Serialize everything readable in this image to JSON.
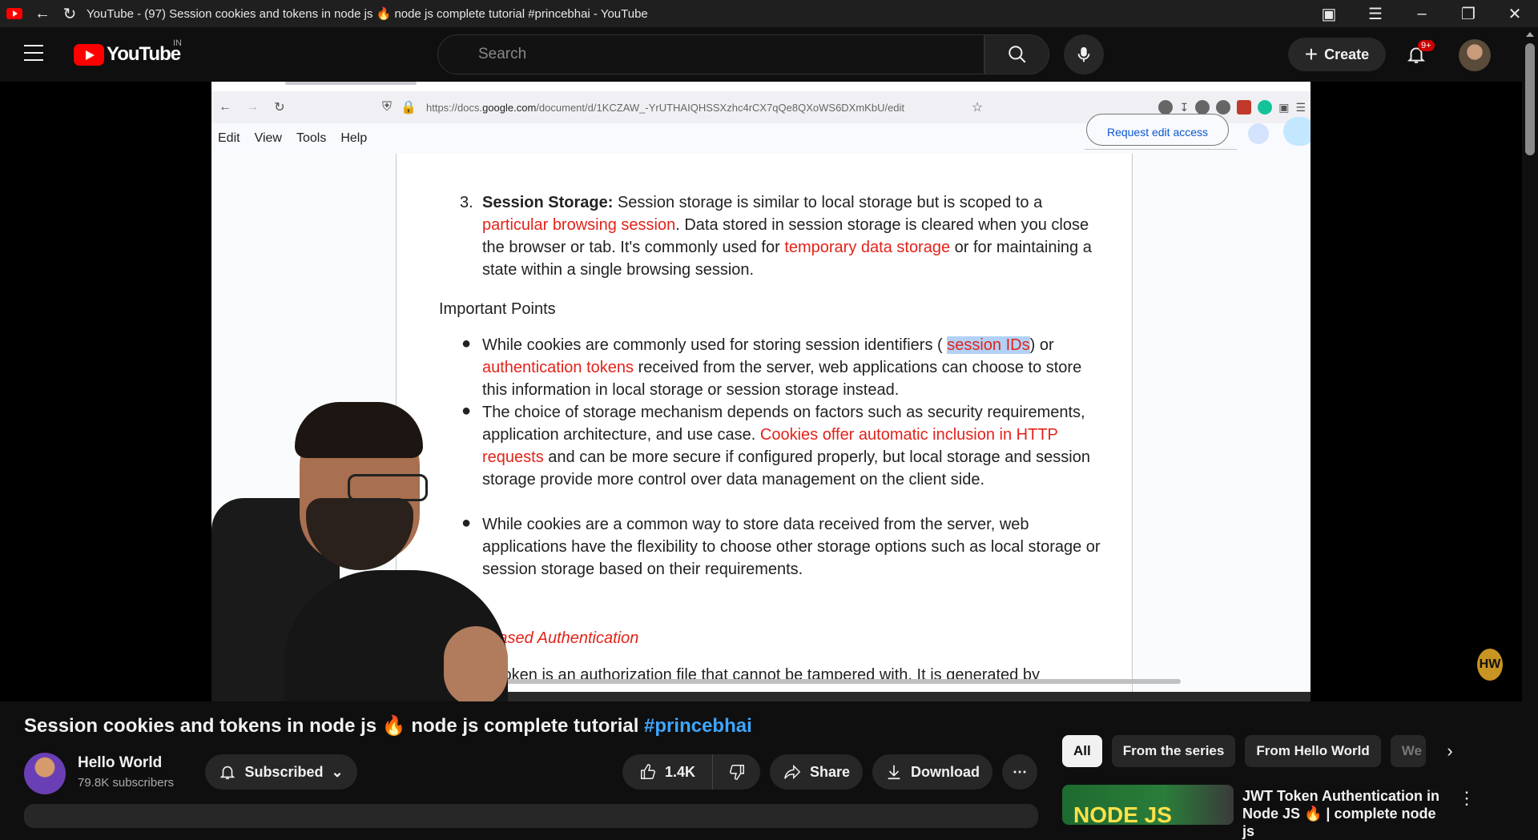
{
  "window": {
    "title": "YouTube - (97) Session cookies and tokens in node js 🔥 node js complete tutorial #princebhai - YouTube"
  },
  "masthead": {
    "logo_text": "YouTube",
    "country_code": "IN",
    "search_placeholder": "Search",
    "create_label": "Create",
    "notification_badge": "9+"
  },
  "inner_browser": {
    "url_prefix": "https://docs.",
    "url_domain": "google.com",
    "url_rest": "/document/d/1KCZAW_-YrUTHAIQHSSXzhc4rCX7qQe8QXoWS6DXmKbU/edit",
    "docs_menu": [
      "Edit",
      "View",
      "Tools",
      "Help"
    ],
    "request_edit": "Request edit access"
  },
  "document": {
    "item_number": "3.",
    "session_storage_label": "Session Storage:",
    "session_storage_text_1": " Session storage is similar to local storage but is scoped to a ",
    "session_storage_red_1": "particular browsing session",
    "session_storage_text_2": ". Data stored in session storage is cleared when you close the browser or tab. It's commonly used for ",
    "session_storage_red_2": "temporary data storage",
    "session_storage_text_3": " or for maintaining a state within a single browsing session.",
    "important_points": "Important Points",
    "bullet1_text_1": "While cookies are commonly used for storing session identifiers ( ",
    "bullet1_highlight": "session IDs",
    "bullet1_text_2": ") or ",
    "bullet1_red": "authentication tokens",
    "bullet1_text_3": " received from the server, web applications can choose to store this information in local storage or session storage instead.",
    "bullet2_text_1": "The choice of storage mechanism depends on factors such as security requirements, application architecture, and use case. ",
    "bullet2_red": "Cookies offer automatic inclusion in HTTP requests",
    "bullet2_text_2": " and can be more secure if configured properly, but local storage and session storage provide more control over data management on the client side.",
    "bullet3_text": "While cookies are a common way to store data received from the server, web applications have the flexibility to choose other storage options such as local storage or session storage based on their requirements.",
    "token_heading": "Token based Authentication",
    "token_line": "token is an authorization file that cannot be tampered with. It is generated by"
  },
  "video": {
    "title_main": "Session cookies and tokens in node js 🔥 node js complete tutorial ",
    "title_hashtag": "#princebhai",
    "channel_name": "Hello World",
    "channel_subs": "79.8K subscribers",
    "subscribed_label": "Subscribed",
    "like_count": "1.4K",
    "share_label": "Share",
    "download_label": "Download",
    "watermark": "HW"
  },
  "sidebar": {
    "chips": [
      "All",
      "From the series",
      "From Hello World",
      "We"
    ],
    "rec_title": "JWT Token Authentication in Node JS 🔥 | complete node js",
    "rec_thumb_text": "NODE JS"
  },
  "colors": {
    "yt_red": "#ff0000",
    "doc_red": "#e2231a",
    "hashtag_blue": "#3ea6ff",
    "highlight": "#b3d1f5"
  }
}
